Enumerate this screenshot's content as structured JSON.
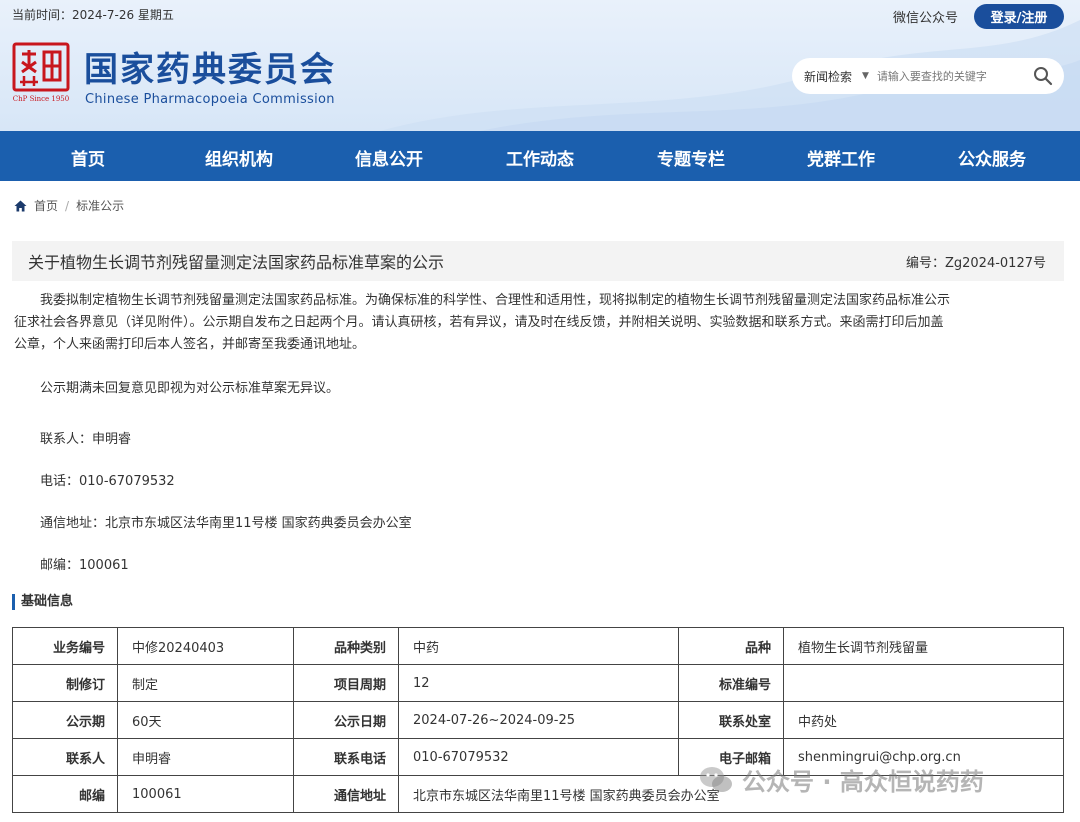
{
  "header": {
    "date_line": "当前时间：2024-7-26 星期五",
    "wechat": "微信公众号",
    "login_label": "登录/注册",
    "site_title": "国家药典委员会",
    "site_subtitle": "Chinese Pharmacopoeia Commission",
    "search": {
      "category": "新闻检索",
      "placeholder": "请输入要查找的关键字"
    },
    "brand_color": "#1a4e9c"
  },
  "nav": {
    "items": [
      "首页",
      "组织机构",
      "信息公开",
      "工作动态",
      "专题专栏",
      "党群工作",
      "公众服务"
    ],
    "color": "#1b5fae"
  },
  "breadcrumb": {
    "home": "首页",
    "current": "标准公示"
  },
  "article": {
    "title": "关于植物生长调节剂残留量测定法国家药品标准草案的公示",
    "number": "编号：Zg2024-0127号",
    "para1_lines": [
      "我委拟制定植物生长调节剂残留量测定法国家药品标准。为确保标准的科学性、合理性和适用性，现将拟制定的植物生长调节剂残留量测定法国家药品标准公示",
      "征求社会各界意见（详见附件）。公示期自发布之日起两个月。请认真研核，若有异议，请及时在线反馈，并附相关说明、实验数据和联系方式。来函需打印后加盖",
      "公章，个人来函需打印后本人签名，并邮寄至我委通讯地址。"
    ],
    "para2": "公示期满未回复意见即视为对公示标准草案无异议。",
    "contact": "联系人：申明睿",
    "phone": "电话：010-67079532",
    "address": "通信地址：北京市东城区法华南里11号楼 国家药典委员会办公室",
    "postcode": "邮编：100061"
  },
  "basic_info": {
    "heading": "基础信息",
    "rows": [
      [
        "业务编号",
        "中修20240403",
        "品种类别",
        "中药",
        "品种",
        "植物生长调节剂残留量"
      ],
      [
        "制修订",
        "制定",
        "项目周期",
        "12",
        "标准编号",
        ""
      ],
      [
        "公示期",
        "60天",
        "公示日期",
        "2024-07-26~2024-09-25",
        "联系处室",
        "中药处"
      ],
      [
        "联系人",
        "申明睿",
        "联系电话",
        "010-67079532",
        "电子邮箱",
        "shenmingrui@chp.org.cn"
      ],
      [
        "邮编",
        "100061",
        "通信地址",
        "北京市东城区法华南里11号楼 国家药典委员会办公室",
        "",
        ""
      ]
    ]
  },
  "watermark": {
    "text": "公众号 · 高众恒说药药"
  }
}
